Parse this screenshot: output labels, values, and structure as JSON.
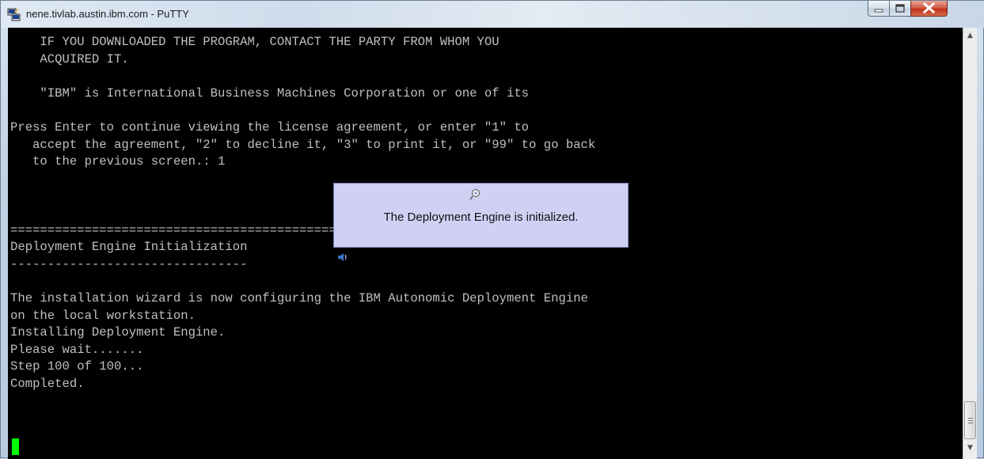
{
  "window": {
    "title": "nene.tivlab.austin.ibm.com - PuTTY",
    "icon": "putty-icon"
  },
  "window_controls": {
    "minimize": "minimize-icon",
    "maximize": "maximize-icon",
    "close": "close-icon"
  },
  "terminal": {
    "lines": [
      "    IF YOU DOWNLOADED THE PROGRAM, CONTACT THE PARTY FROM WHOM YOU",
      "    ACQUIRED IT.",
      "",
      "    \"IBM\" is International Business Machines Corporation or one of its",
      "",
      "Press Enter to continue viewing the license agreement, or enter \"1\" to",
      "   accept the agreement, \"2\" to decline it, \"3\" to print it, or \"99\" to go back",
      "   to the previous screen.: 1",
      "",
      "",
      "",
      "===============================================================================",
      "Deployment Engine Initialization",
      "--------------------------------",
      "",
      "The installation wizard is now configuring the IBM Autonomic Deployment Engine",
      "on the local workstation.",
      "Installing Deployment Engine.",
      "Please wait.......",
      "Step 100 of 100...",
      "Completed."
    ],
    "text_color": "#c0c0c0",
    "cursor_color": "#00ff00"
  },
  "notification": {
    "icon": "balloon-info-icon",
    "text": "The Deployment Engine is initialized.",
    "background": "#cfd0f4"
  },
  "speaker": {
    "icon": "speaker-icon"
  },
  "scrollbar": {
    "up_icon": "scroll-up-arrow-icon",
    "down_icon": "scroll-down-arrow-icon"
  }
}
